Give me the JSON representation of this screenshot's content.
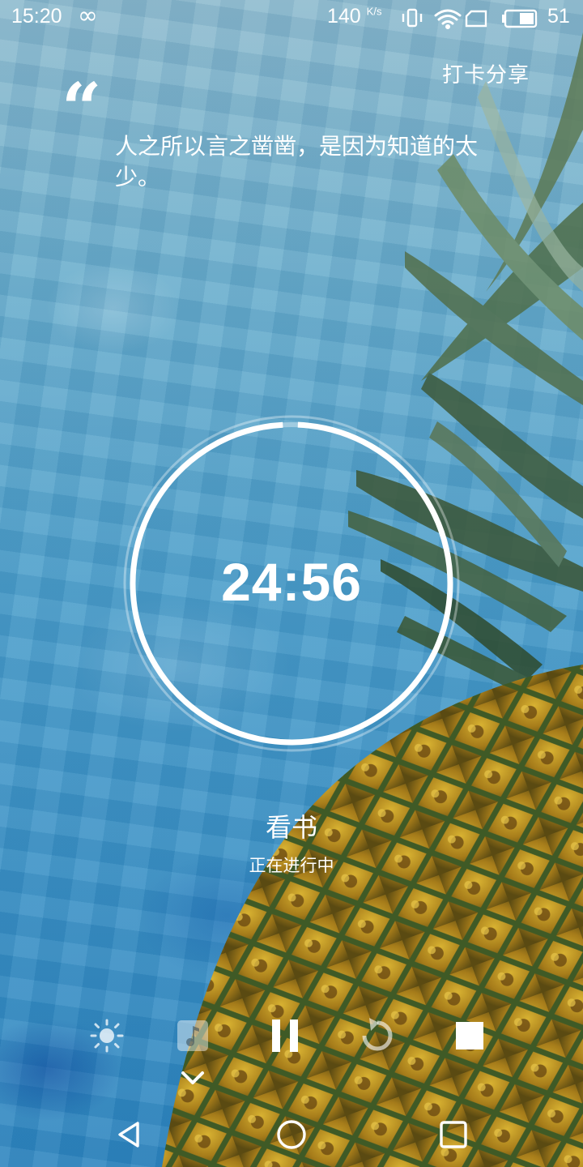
{
  "status_bar": {
    "time": "15:20",
    "infinity_symbol": "∞",
    "net_speed": "140",
    "net_unit": "K/s",
    "battery_level": "51",
    "icons": [
      "vibrate-icon",
      "wifi-icon",
      "sim-icon",
      "battery-icon"
    ]
  },
  "header": {
    "share_label": "打卡分享"
  },
  "quote": {
    "mark": "“",
    "text": "人之所以言之凿凿，是因为知道的太少。"
  },
  "timer": {
    "display": "24:56",
    "progress_fraction": 0.985
  },
  "task": {
    "name": "看书",
    "status": "正在进行中"
  },
  "controls": [
    "brightness-icon",
    "music-icon",
    "pause-icon",
    "restart-icon",
    "stop-icon",
    "collapse-chevron-icon"
  ],
  "navigation": [
    "back-icon",
    "home-icon",
    "recents-icon"
  ],
  "colors": {
    "water": "#4d9fcb",
    "text": "#ffffff",
    "pineapple_leaf": "#3c5a3a",
    "pineapple_body": "#c9a22a"
  }
}
